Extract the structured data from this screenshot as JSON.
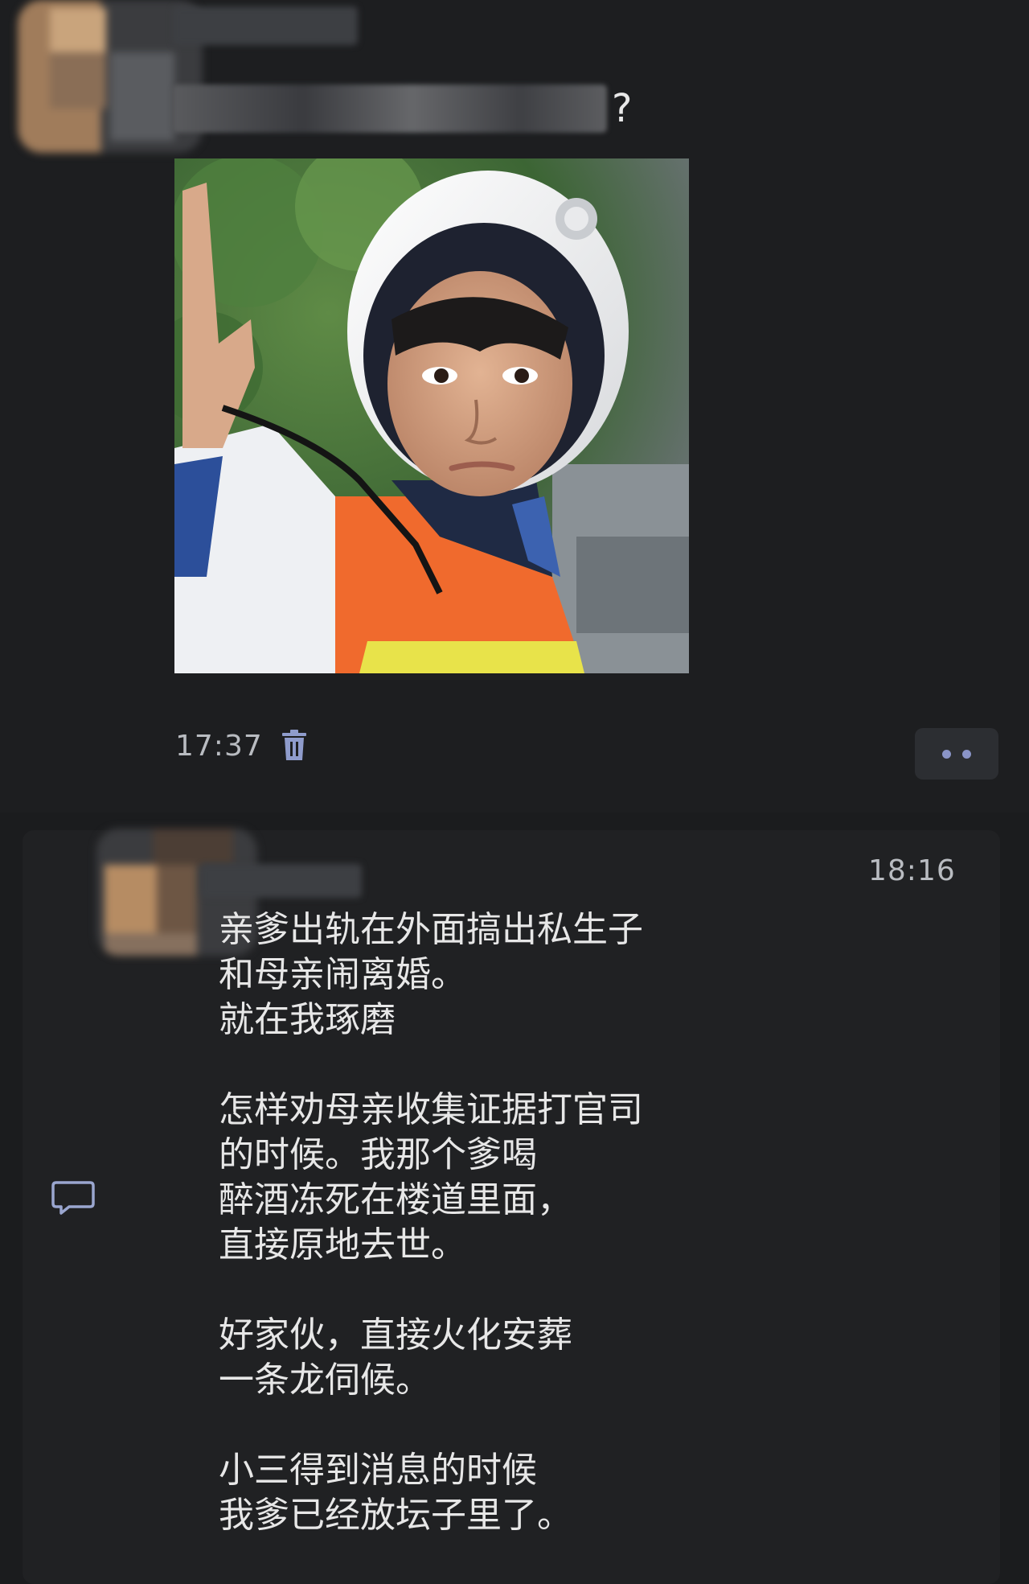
{
  "post": {
    "question_suffix": "?",
    "time": "17:37"
  },
  "reply": {
    "time": "18:16",
    "paragraphs": [
      [
        "亲爹出轨在外面搞出私生子",
        "和母亲闹离婚。",
        "就在我琢磨"
      ],
      [
        "怎样劝母亲收集证据打官司",
        "的时候。我那个爹喝",
        "醉酒冻死在楼道里面，",
        "直接原地去世。"
      ],
      [
        "好家伙，直接火化安葬",
        "一条龙伺候。"
      ],
      [
        "小三得到消息的时候",
        "我爹已经放坛子里了。"
      ]
    ]
  },
  "icons": {
    "delete": "trash-icon",
    "more": "more-options-icon",
    "comment": "comment-icon"
  },
  "colors": {
    "background": "#1b1c1e",
    "card": "#202123",
    "text": "#e7e7e7",
    "meta": "#b9bcc1",
    "accent_dots": "#8a94c7"
  }
}
